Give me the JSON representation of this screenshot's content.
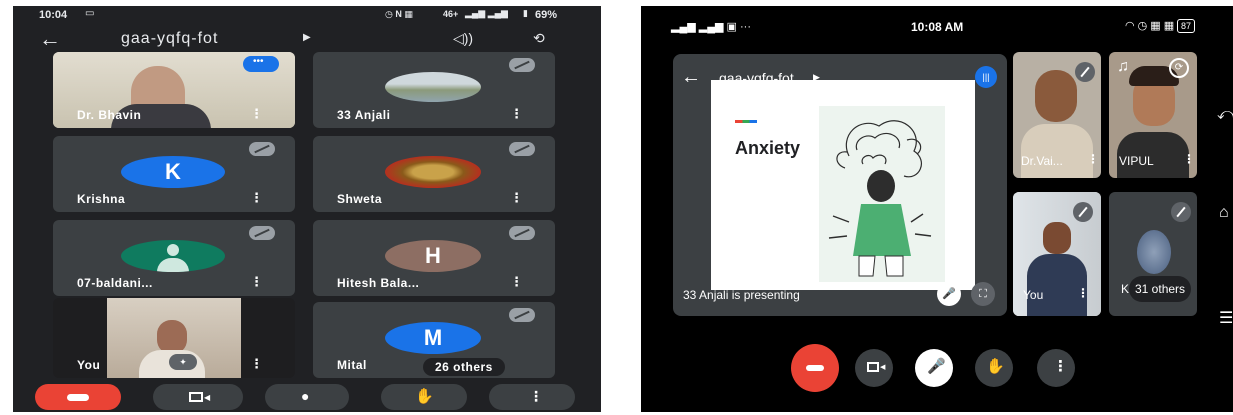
{
  "left": {
    "status": {
      "time": "10:04",
      "network": "46+",
      "battery": "69%"
    },
    "meeting_code": "gaa-yqfq-fot",
    "tiles": [
      {
        "name": "Dr. Bhavin"
      },
      {
        "name": "33 Anjali"
      },
      {
        "name": "Krishna",
        "initial": "K"
      },
      {
        "name": "Shweta"
      },
      {
        "name": "07-baldani..."
      },
      {
        "name": "Hitesh Bala...",
        "initial": "H"
      },
      {
        "name": "You"
      },
      {
        "name": "Mital",
        "initial": "M",
        "others": "26 others"
      }
    ]
  },
  "right": {
    "status": {
      "time": "10:08 AM",
      "battery": "87"
    },
    "meeting_code": "gaa-yqfq-fot",
    "slide_title": "Anxiety",
    "presenting_text": "33 Anjali is presenting",
    "tiles": [
      {
        "name": "Dr.Vai..."
      },
      {
        "name": "VIPUL"
      },
      {
        "name": "You"
      },
      {
        "name": "K",
        "others": "31 others"
      }
    ]
  },
  "colors": {
    "left_bg": "#202124",
    "tile_bg": "#3c4043",
    "end_call": "#ea4335",
    "blue_avatar": "#1a73e8",
    "green_avatar": "#0f7b5f",
    "brown_avatar": "#8d6e63",
    "slide_green": "#4caf72"
  }
}
